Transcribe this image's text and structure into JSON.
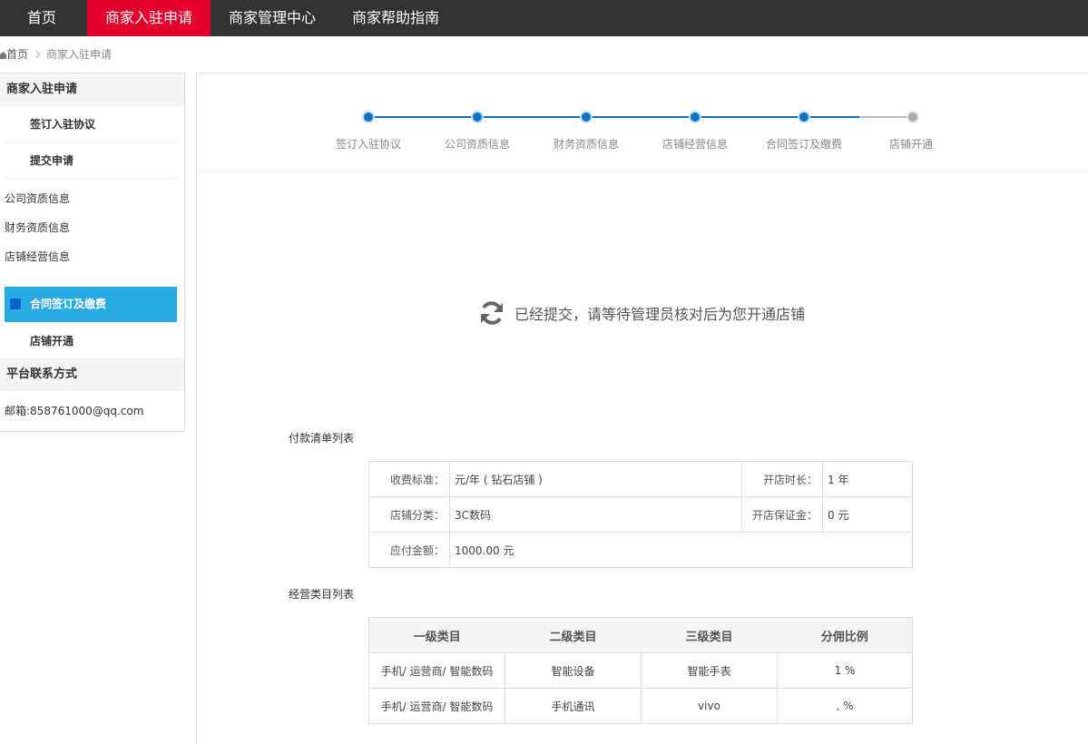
{
  "nav": {
    "items": [
      {
        "label": "首页"
      },
      {
        "label": "商家入驻申请"
      },
      {
        "label": "商家管理中心"
      },
      {
        "label": "商家帮助指南"
      }
    ]
  },
  "breadcrumb": {
    "home": "首页",
    "current": "商家入驻申请"
  },
  "sidebar": {
    "section1_title": "商家入驻申请",
    "sub1": "签订入驻协议",
    "sub2": "提交申请",
    "plain": [
      "公司资质信息",
      "财务资质信息",
      "店铺经营信息"
    ],
    "active": "合同签订及缴费",
    "sub3": "店铺开通",
    "section2_title": "平台联系方式",
    "contact": "邮箱:858761000@qq.com"
  },
  "steps": [
    {
      "label": "签订入驻协议",
      "done": true
    },
    {
      "label": "公司资质信息",
      "done": true
    },
    {
      "label": "财务资质信息",
      "done": true
    },
    {
      "label": "店铺经营信息",
      "done": true
    },
    {
      "label": "合同签订及缴费",
      "done": true
    },
    {
      "label": "店铺开通",
      "done": false
    }
  ],
  "status_text": "已经提交，请等待管理员核对后为您开通店铺",
  "payment": {
    "title": "付款清单列表",
    "fee_label": "收费标准：",
    "fee_value": "元/年 ( 钻石店铺 )",
    "duration_label": "开店时长：",
    "duration_value": "1 年",
    "category_label": "店铺分类：",
    "category_value": "3C数码",
    "deposit_label": "开店保证金：",
    "deposit_value": "0 元",
    "amount_label": "应付金额：",
    "amount_value": "1000.00 元"
  },
  "categories": {
    "title": "经营类目列表",
    "headers": [
      "一级类目",
      "二级类目",
      "三级类目",
      "分佣比例"
    ],
    "rows": [
      [
        "手机/ 运营商/ 智能数码",
        "智能设备",
        "智能手表",
        "1 %"
      ],
      [
        "手机/ 运营商/ 智能数码",
        "手机通讯",
        "vivo",
        ", %"
      ]
    ]
  }
}
